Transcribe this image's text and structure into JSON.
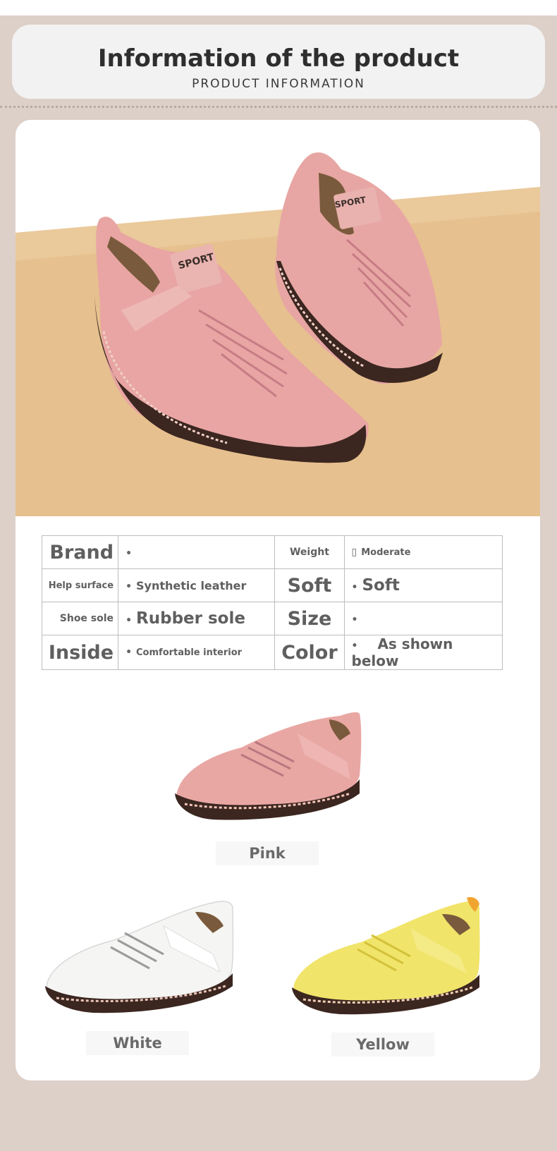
{
  "header": {
    "title": "Information of the product",
    "subtitle": "PRODUCT INFORMATION"
  },
  "hero": {
    "shoe_text": "SPORT",
    "colors": {
      "background": "#e6c08e",
      "shoe": "#e8a5a3",
      "sole": "#3b2620"
    }
  },
  "specs": {
    "brand_label": "Brand",
    "brand_value": "",
    "weight_label": "Weight",
    "weight_value": "Moderate",
    "upper_label": "Help surface",
    "upper_value": "Synthetic leather",
    "soft_label": "Soft",
    "soft_value": "Soft",
    "sole_label": "Shoe sole",
    "sole_value": "Rubber sole",
    "size_label": "Size",
    "size_value": "",
    "inside_label": "Inside",
    "inside_value": "Comfortable interior",
    "color_label": "Color",
    "color_value": "As shown below",
    "bullet": "•"
  },
  "variants": [
    {
      "name": "Pink",
      "color": "#e9a7a4"
    },
    {
      "name": "White",
      "color": "#f4f4f2"
    },
    {
      "name": "Yellow",
      "color": "#f1e46a"
    }
  ]
}
